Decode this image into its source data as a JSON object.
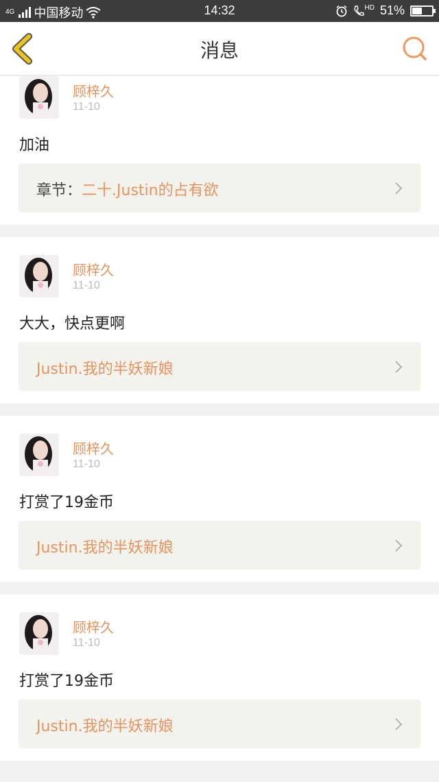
{
  "status_bar": {
    "network": "4G",
    "carrier": "中国移动",
    "time": "14:32",
    "hd": "HD",
    "battery": "51%",
    "battery_level": 0.51
  },
  "nav": {
    "title": "消息",
    "back_icon": "chevron-left-icon",
    "search_icon": "search-icon"
  },
  "colors": {
    "accent": "#e8925e",
    "back_icon": "#ecc41d",
    "ref_bg": "#f3f3ee"
  },
  "messages": [
    {
      "user": "顾梓久",
      "date": "11-10",
      "text": "加油",
      "ref_prefix": "章节：",
      "ref_link": "二十.Justin的占有欲"
    },
    {
      "user": "顾梓久",
      "date": "11-10",
      "text": "大大，快点更啊",
      "ref_prefix": "",
      "ref_link": "Justin.我的半妖新娘"
    },
    {
      "user": "顾梓久",
      "date": "11-10",
      "text": "打赏了19金币",
      "ref_prefix": "",
      "ref_link": "Justin.我的半妖新娘"
    },
    {
      "user": "顾梓久",
      "date": "11-10",
      "text": "打赏了19金币",
      "ref_prefix": "",
      "ref_link": "Justin.我的半妖新娘"
    }
  ]
}
